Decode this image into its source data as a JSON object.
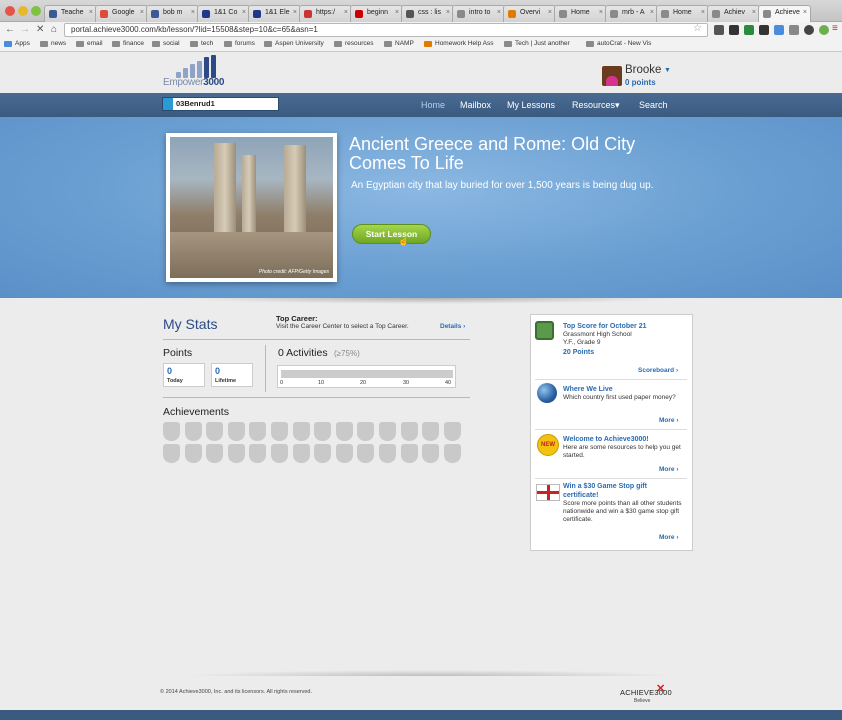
{
  "browser": {
    "tabs": [
      {
        "label": "Teache",
        "color": "#3b5998"
      },
      {
        "label": "Google",
        "color": "#dd4b39"
      },
      {
        "label": "bob m",
        "color": "#3b5998"
      },
      {
        "label": "1&1 Co",
        "color": "#1a3a8a"
      },
      {
        "label": "1&1 Ele",
        "color": "#1a3a8a"
      },
      {
        "label": "https:/",
        "color": "#cc3333"
      },
      {
        "label": "beginn",
        "color": "#cc0000"
      },
      {
        "label": "css : lis",
        "color": "#555555"
      },
      {
        "label": "intro to",
        "color": "#8a8a8a"
      },
      {
        "label": "Overvi",
        "color": "#e07b00"
      },
      {
        "label": "Home",
        "color": "#8a8a8a"
      },
      {
        "label": "mrb - A",
        "color": "#8a8a8a"
      },
      {
        "label": "Home",
        "color": "#8a8a8a"
      },
      {
        "label": "Achiev",
        "color": "#8a8a8a"
      },
      {
        "label": "Achieve",
        "color": "#8a8a8a"
      }
    ],
    "url": "portal.achieve3000.com/kb/lesson/?lid=15508&step=10&c=65&asn=1",
    "bookmarks": [
      "Apps",
      "news",
      "email",
      "finance",
      "social",
      "tech",
      "forums",
      "Aspen University",
      "resources",
      "NAMP",
      "Homework Help Ass",
      "Tech | Just another",
      "autoCrat - New Vis"
    ]
  },
  "header": {
    "logo_prefix": "Empower",
    "logo_suffix": "3000",
    "user_name": "Brooke",
    "user_points": "0 points",
    "search_value": "03Benrud1"
  },
  "nav": {
    "items": [
      "Home",
      "Mailbox",
      "My Lessons",
      "Resources",
      "Search"
    ],
    "resources_caret": "▾"
  },
  "hero": {
    "title": "Ancient Greece and Rome: Old City Comes To Life",
    "subtitle": "An Egyptian city that lay buried for over 1,500 years is being dug up.",
    "button": "Start Lesson",
    "photo_credit": "Photo credit: AFP/Getty Images"
  },
  "stats": {
    "title": "My Stats",
    "career_label": "Top Career:",
    "career_text": "Visit the Career Center to select a Top Career.",
    "details": "Details",
    "points_title": "Points",
    "today_value": "0",
    "today_label": "Today",
    "lifetime_value": "0",
    "lifetime_label": "Lifetime",
    "activities_title": "0 Activities",
    "activities_pct": "(≥75%)",
    "activity_progress": 0,
    "ticks": [
      "0",
      "10",
      "20",
      "30",
      "40"
    ],
    "achievements_title": "Achievements",
    "achievement_badges": 28
  },
  "sidebar": {
    "top_score": {
      "title": "Top Score for October 21",
      "school": "Grassmont High School",
      "student": "Y.F., Grade 9",
      "points": "20 Points",
      "link": "Scoreboard"
    },
    "where_we_live": {
      "title": "Where We Live",
      "text": "Which country first used paper money?",
      "link": "More"
    },
    "welcome": {
      "badge": "NEW",
      "title": "Welcome to Achieve3000!",
      "text": "Here are some resources to help you get started.",
      "link": "More"
    },
    "gift": {
      "title": "Win a $30 Game Stop gift certificate!",
      "text": "Score more points than all other students nationwide and win a $30 game stop gift certificate.",
      "link": "More"
    },
    "chevron": "›"
  },
  "footer": {
    "copyright": "© 2014 Achieve3000, Inc. and its licensors. All rights reserved.",
    "logo": "ACHIEVE3000",
    "tagline": "Believe"
  }
}
